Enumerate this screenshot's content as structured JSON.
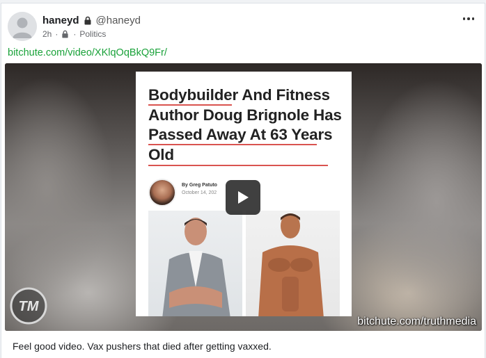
{
  "post": {
    "author_name": "haneyd",
    "author_handle": "@haneyd",
    "time": "2h",
    "visibility_icon": "lock-icon",
    "group": "Politics",
    "more_icon": "more-options-icon",
    "link": "bitchute.com/video/XKlqOqBkQ9Fr/",
    "caption": "Feel good video. Vax pushers that died after getting vaxxed."
  },
  "video": {
    "headline": "Bodybuilder And Fitness Author Doug Brignole Has Passed Away At 63 Years Old",
    "byline_name": "By Greg Patuto",
    "byline_date": "October 14, 202",
    "watermark": "bitchute.com/truthmedia",
    "logo_text": "TM",
    "play_icon": "play-icon"
  }
}
